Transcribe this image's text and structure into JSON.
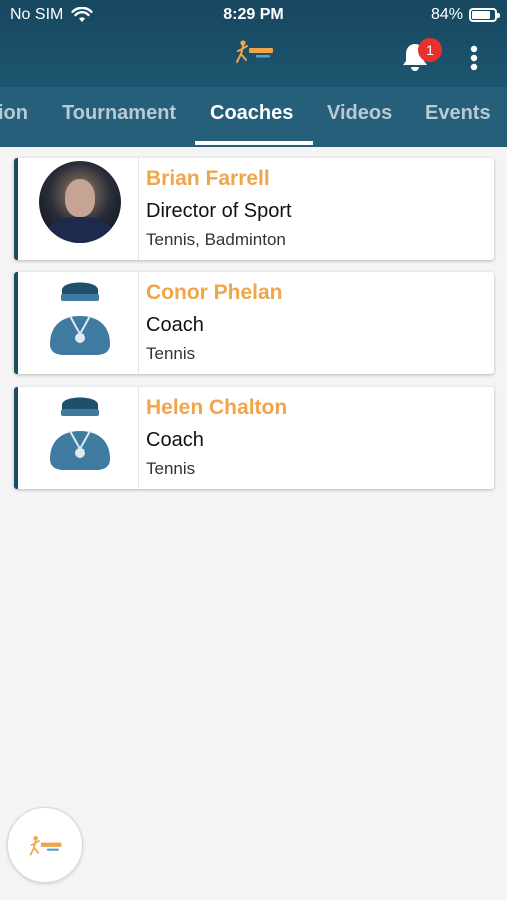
{
  "status_bar": {
    "carrier": "No SIM",
    "time": "8:29 PM",
    "battery": "84%",
    "battery_level": 0.84
  },
  "header": {
    "logo_icon": "ignite-logo-icon",
    "notifications_count": "1",
    "bell_icon": "bell-icon",
    "menu_icon": "more-vertical-icon"
  },
  "tabs": [
    {
      "label": "ion"
    },
    {
      "label": "Tournament"
    },
    {
      "label": "Coaches",
      "active": true
    },
    {
      "label": "Videos"
    },
    {
      "label": "Events"
    }
  ],
  "coaches": [
    {
      "name": "Brian Farrell",
      "role": "Director of Sport",
      "sports": "Tennis, Badminton",
      "avatar": "photo"
    },
    {
      "name": "Conor Phelan",
      "role": "Coach",
      "sports": "Tennis",
      "avatar": "coach-placeholder-icon"
    },
    {
      "name": "Helen Chalton",
      "role": "Coach",
      "sports": "Tennis",
      "avatar": "coach-placeholder-icon"
    }
  ],
  "colors": {
    "header_bg": "#17475f",
    "tab_bg": "#265f79",
    "accent_orange": "#f0a54a",
    "card_border": "#1c4d66",
    "badge_red": "#e8312f"
  }
}
